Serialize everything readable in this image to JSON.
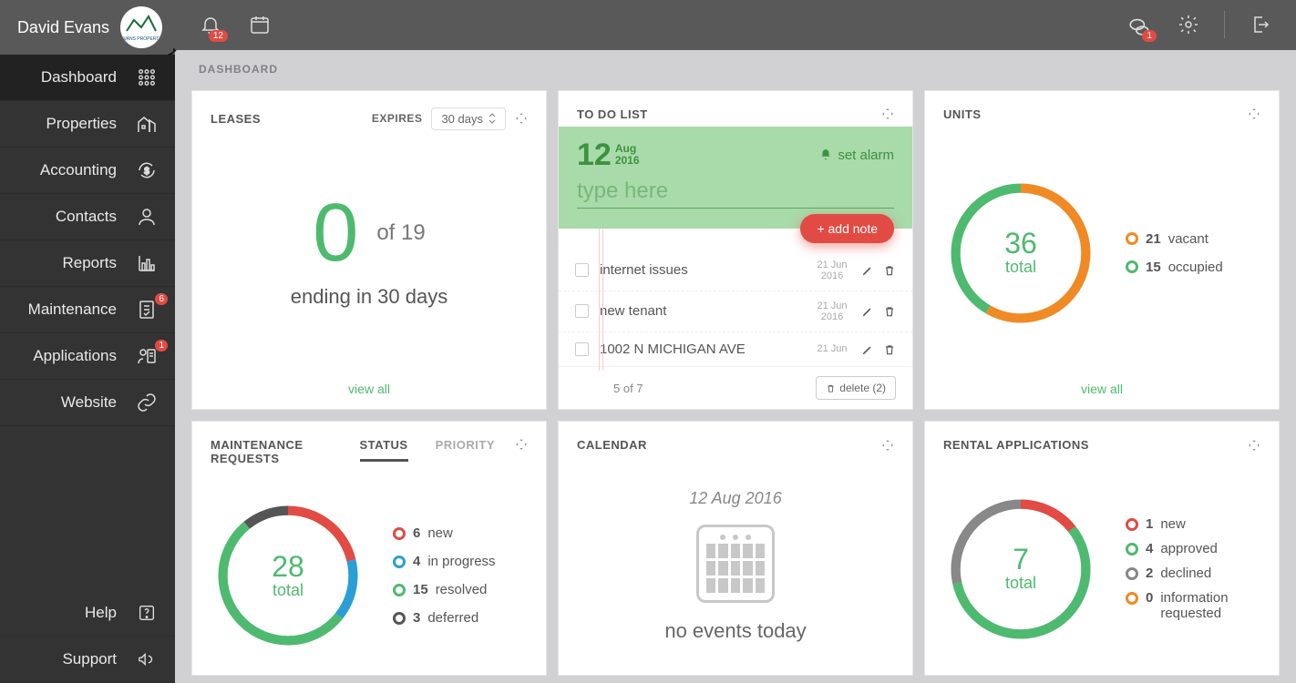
{
  "user": {
    "name": "David Evans",
    "logo_text": "EVANS PROPERTY"
  },
  "topbar": {
    "notif_badge": "12",
    "chat_badge": "1"
  },
  "breadcrumb": "DASHBOARD",
  "sidebar": {
    "items": [
      {
        "label": "Dashboard"
      },
      {
        "label": "Properties"
      },
      {
        "label": "Accounting"
      },
      {
        "label": "Contacts"
      },
      {
        "label": "Reports"
      },
      {
        "label": "Maintenance",
        "badge": "6"
      },
      {
        "label": "Applications",
        "badge": "1"
      },
      {
        "label": "Website"
      }
    ],
    "footer": [
      {
        "label": "Help"
      },
      {
        "label": "Support"
      }
    ]
  },
  "leases": {
    "title": "LEASES",
    "expires_label": "EXPIRES",
    "range_select": "30 days",
    "count": "0",
    "of_total": "of 19",
    "ending_text": "ending in 30 days",
    "view_all": "view all"
  },
  "todo": {
    "title": "TO DO LIST",
    "day": "12",
    "month": "Aug",
    "year": "2016",
    "alarm_label": "set alarm",
    "input_placeholder": "type here",
    "add_note": "+ add note",
    "items": [
      {
        "text": "internet issues",
        "date_top": "21 Jun",
        "date_bot": "2016"
      },
      {
        "text": "new tenant",
        "date_top": "21 Jun",
        "date_bot": "2016"
      },
      {
        "text": "1002 N MICHIGAN AVE",
        "date_top": "21 Jun",
        "date_bot": ""
      }
    ],
    "count": "5 of 7",
    "delete_label": "delete (2)"
  },
  "units": {
    "title": "UNITS",
    "total": "36",
    "total_label": "total",
    "legend": [
      {
        "count": "21",
        "label": "vacant",
        "color": "#f08a24"
      },
      {
        "count": "15",
        "label": "occupied",
        "color": "#4eba6f"
      }
    ],
    "view_all": "view all"
  },
  "maintenance": {
    "title_line1": "MAINTENANCE",
    "title_line2": "REQUESTS",
    "tab_status": "STATUS",
    "tab_priority": "PRIORITY",
    "total": "28",
    "total_label": "total",
    "legend": [
      {
        "count": "6",
        "label": "new",
        "color": "#e14b44"
      },
      {
        "count": "4",
        "label": "in progress",
        "color": "#2a9fd6"
      },
      {
        "count": "15",
        "label": "resolved",
        "color": "#4eba6f"
      },
      {
        "count": "3",
        "label": "deferred",
        "color": "#555"
      }
    ]
  },
  "calendar": {
    "title": "CALENDAR",
    "date": "12 Aug 2016",
    "no_events": "no events today"
  },
  "rental": {
    "title": "RENTAL APPLICATIONS",
    "total": "7",
    "total_label": "total",
    "legend": [
      {
        "count": "1",
        "label": "new",
        "color": "#e14b44"
      },
      {
        "count": "4",
        "label": "approved",
        "color": "#4eba6f"
      },
      {
        "count": "2",
        "label": "declined",
        "color": "#888"
      },
      {
        "count": "0",
        "label": "information requested",
        "color": "#f08a24"
      }
    ]
  },
  "chart_data": [
    {
      "type": "pie",
      "title": "UNITS",
      "series": [
        {
          "name": "vacant",
          "value": 21,
          "color": "#f08a24"
        },
        {
          "name": "occupied",
          "value": 15,
          "color": "#4eba6f"
        }
      ],
      "total": 36
    },
    {
      "type": "pie",
      "title": "MAINTENANCE REQUESTS",
      "series": [
        {
          "name": "new",
          "value": 6,
          "color": "#e14b44"
        },
        {
          "name": "in progress",
          "value": 4,
          "color": "#2a9fd6"
        },
        {
          "name": "resolved",
          "value": 15,
          "color": "#4eba6f"
        },
        {
          "name": "deferred",
          "value": 3,
          "color": "#555"
        }
      ],
      "total": 28
    },
    {
      "type": "pie",
      "title": "RENTAL APPLICATIONS",
      "series": [
        {
          "name": "new",
          "value": 1,
          "color": "#e14b44"
        },
        {
          "name": "approved",
          "value": 4,
          "color": "#4eba6f"
        },
        {
          "name": "declined",
          "value": 2,
          "color": "#888"
        },
        {
          "name": "information requested",
          "value": 0,
          "color": "#f08a24"
        }
      ],
      "total": 7
    }
  ]
}
